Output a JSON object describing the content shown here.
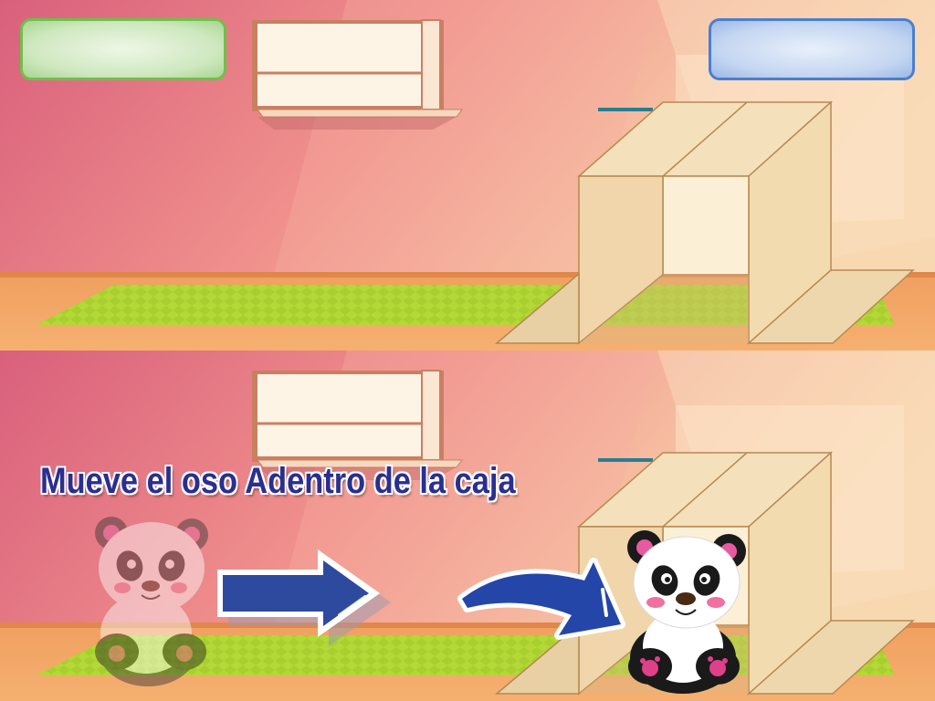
{
  "instruction": "Mueve el oso Adentro de la caja",
  "colors": {
    "wall_top": "#e8798c",
    "wall_light": "#f4b3a4",
    "floor": "#f2a35c",
    "rug": "#a8d12f",
    "box": "#f5dfb8",
    "box_dark": "#e8c89a",
    "box_edge": "#b88850",
    "arrow_blue": "#2e4a9e",
    "score_green": "#6fbf4c",
    "score_blue": "#4a7fd0"
  },
  "icons": {
    "faded_bear": "panda-icon",
    "straight_arrow": "arrow-right-icon",
    "curved_arrow": "curved-arrow-icon",
    "target_bear": "panda-icon"
  }
}
